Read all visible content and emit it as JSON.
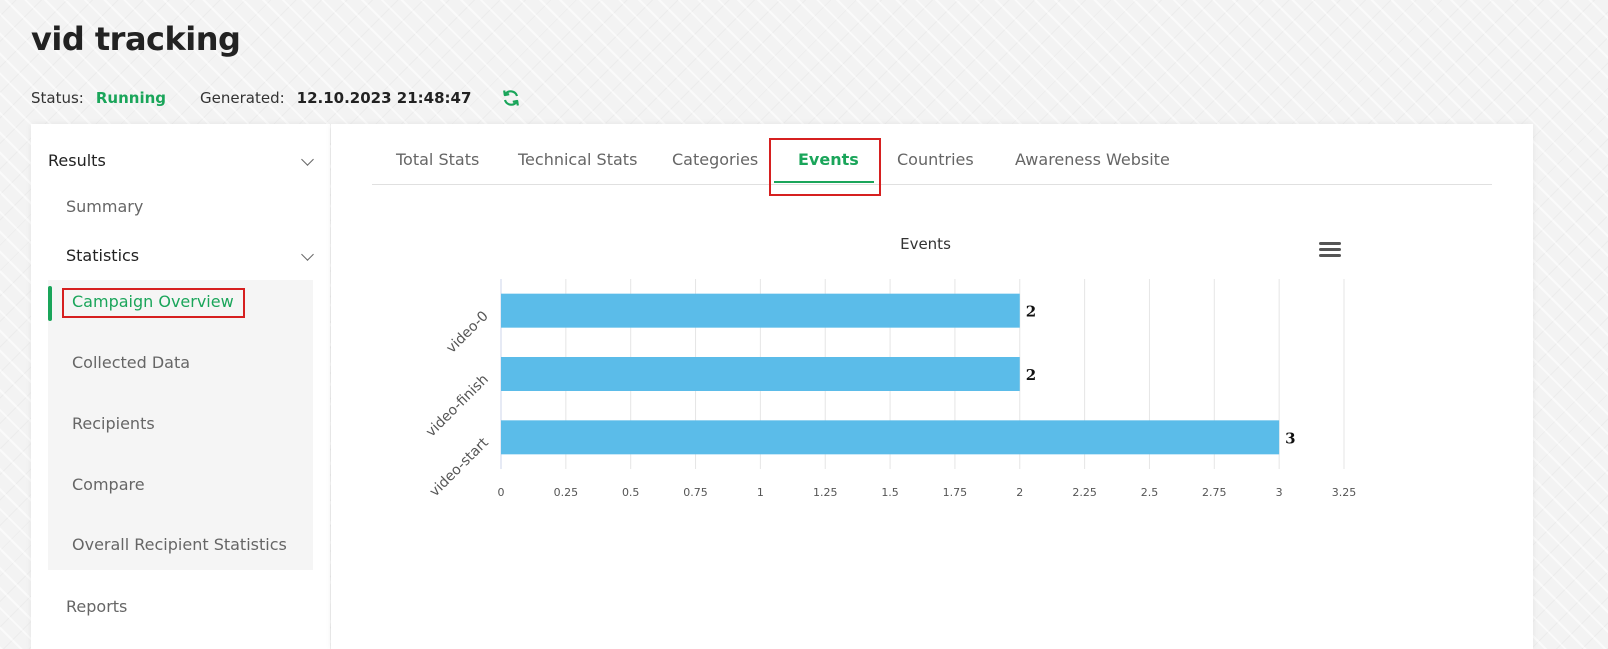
{
  "page": {
    "title": "vid tracking"
  },
  "status": {
    "status_label": "Status:",
    "status_value": "Running",
    "generated_label": "Generated:",
    "generated_value": "12.10.2023 21:48:47"
  },
  "sidebar": {
    "results_label": "Results",
    "summary_label": "Summary",
    "statistics_label": "Statistics",
    "sub_items": [
      "Campaign Overview",
      "Collected Data",
      "Recipients",
      "Compare",
      "Overall Recipient Statistics"
    ],
    "reports_label": "Reports"
  },
  "tabs": [
    "Total Stats",
    "Technical Stats",
    "Categories",
    "Events",
    "Countries",
    "Awareness Website"
  ],
  "colors": {
    "accent": "#1aa55a",
    "bar": "#5bbce9",
    "highlight": "#d62020"
  },
  "chart_data": {
    "type": "bar",
    "orientation": "horizontal",
    "title": "Events",
    "categories": [
      "video-0",
      "video-finish",
      "video-start"
    ],
    "values": [
      2,
      2,
      3
    ],
    "data_labels": [
      "2",
      "2",
      "3"
    ],
    "xlim": [
      0,
      3.25
    ],
    "x_ticks": [
      "0",
      "0.25",
      "0.5",
      "0.75",
      "1",
      "1.25",
      "1.5",
      "1.75",
      "2",
      "2.25",
      "2.5",
      "2.75",
      "3",
      "3.25"
    ],
    "xlabel": "",
    "ylabel": "",
    "grid": true,
    "legend": "none"
  }
}
